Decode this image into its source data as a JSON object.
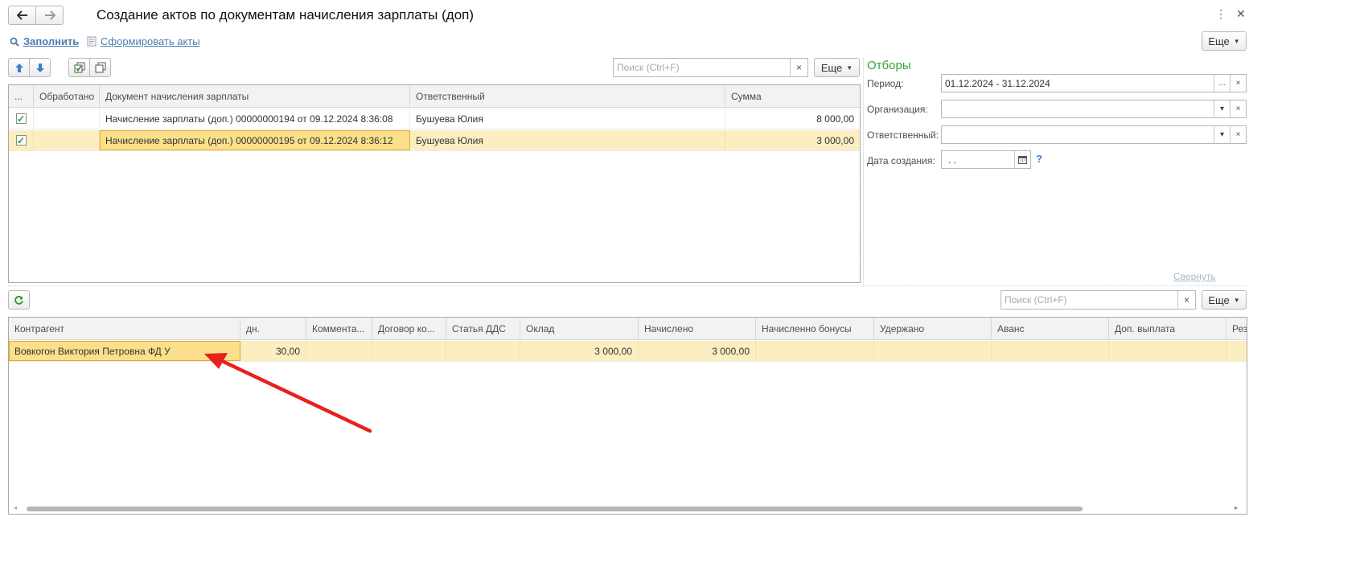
{
  "window": {
    "title": "Создание актов по документам начисления зарплаты (доп)",
    "menu_icon": "vertical-dots-icon",
    "close_icon": "close-icon"
  },
  "nav": {
    "back_icon": "arrow-left-icon",
    "forward_icon": "arrow-right-icon"
  },
  "command_bar": {
    "fill_label": "Заполнить",
    "create_acts_label": "Сформировать акты",
    "more_label": "Еще"
  },
  "top_toolbar": {
    "search_placeholder": "Поиск (Ctrl+F)",
    "clear": "×",
    "more_label": "Еще"
  },
  "documents_table": {
    "columns": [
      "...",
      "Обработано",
      "Документ начисления зарплаты",
      "Ответственный",
      "Сумма"
    ],
    "rows": [
      {
        "checked": true,
        "processed": "",
        "document": "Начисление зарплаты (доп.) 00000000194 от 09.12.2024 8:36:08",
        "responsible": "Бушуева Юлия",
        "sum": "8 000,00"
      },
      {
        "checked": true,
        "processed": "",
        "document": "Начисление зарплаты (доп.) 00000000195 от 09.12.2024 8:36:12",
        "responsible": "Бушуева Юлия",
        "sum": "3 000,00"
      }
    ]
  },
  "filters": {
    "title": "Отборы",
    "period_label": "Период:",
    "period_value": "01.12.2024 - 31.12.2024",
    "organization_label": "Организация:",
    "organization_value": "",
    "responsible_label": "Ответственный:",
    "responsible_value": "",
    "created_label": "Дата создания:",
    "created_value": " .  .",
    "help": "?",
    "collapse_label": "Свернуть",
    "ellipsis": "...",
    "clear": "×",
    "dropdown": "▾"
  },
  "bottom_toolbar": {
    "refresh_icon": "refresh-icon",
    "search_placeholder": "Поиск (Ctrl+F)",
    "clear": "×",
    "more_label": "Еще"
  },
  "contractors_table": {
    "columns": [
      "Контрагент",
      "дн.",
      "Коммента...",
      "Договор ко...",
      "Статья ДДС",
      "Оклад",
      "Начислено",
      "Начисленно бонусы",
      "Удержано",
      "Аванс",
      "Доп. выплата",
      "Рез"
    ],
    "rows": [
      {
        "contractor": "Вовкогон Виктория Петровна ФД У",
        "days": "30,00",
        "comment": "",
        "contract": "",
        "cash_item": "",
        "salary": "3 000,00",
        "accrued": "3 000,00",
        "bonuses": "",
        "withheld": "",
        "advance": "",
        "extra": "",
        "rest": ""
      }
    ]
  },
  "annotation": {
    "color": "#e8201e"
  }
}
